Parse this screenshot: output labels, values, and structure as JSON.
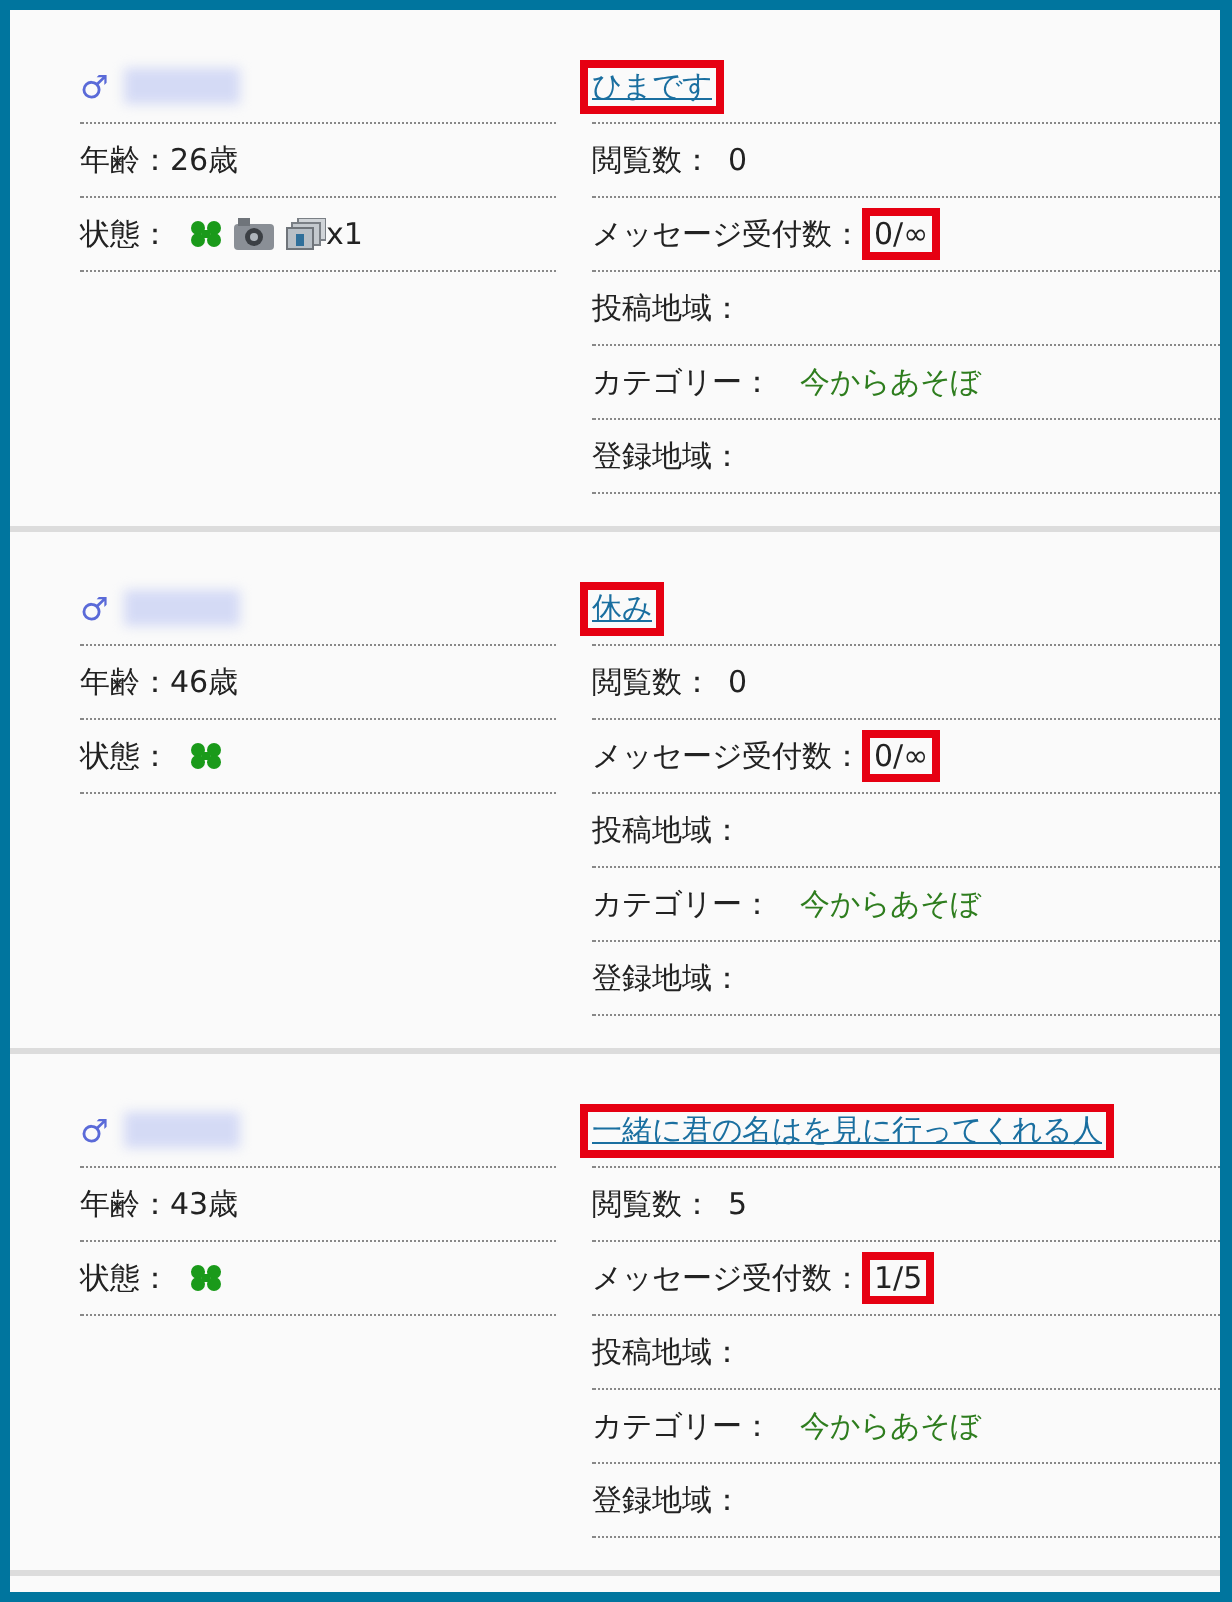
{
  "cards": [
    {
      "gender_symbol": "♂",
      "age": "年齢：26歳",
      "status_label": "状態：",
      "status_icons": [
        {
          "kind": "clover"
        },
        {
          "kind": "camera"
        },
        {
          "kind": "photos",
          "count": "x1"
        }
      ],
      "title": "ひまです",
      "title_highlighted": true,
      "fields": [
        {
          "kind": "plain",
          "label": "閲覧数：",
          "value": "0",
          "highlighted": false
        },
        {
          "kind": "plain",
          "label": "メッセージ受付数：",
          "value": "0/∞",
          "highlighted": true
        },
        {
          "kind": "hidden",
          "label": "投稿地域："
        },
        {
          "kind": "category",
          "label": "カテゴリー：",
          "value": "今からあそぼ",
          "highlighted": false
        },
        {
          "kind": "hidden",
          "label": "登録地域："
        }
      ]
    },
    {
      "gender_symbol": "♂",
      "age": "年齢：46歳",
      "status_label": "状態：",
      "status_icons": [
        {
          "kind": "clover"
        }
      ],
      "title": "休み",
      "title_highlighted": true,
      "fields": [
        {
          "kind": "plain",
          "label": "閲覧数：",
          "value": "0",
          "highlighted": false
        },
        {
          "kind": "plain",
          "label": "メッセージ受付数：",
          "value": "0/∞",
          "highlighted": true
        },
        {
          "kind": "hidden",
          "label": "投稿地域："
        },
        {
          "kind": "category",
          "label": "カテゴリー：",
          "value": "今からあそぼ",
          "highlighted": false
        },
        {
          "kind": "hidden",
          "label": "登録地域："
        }
      ]
    },
    {
      "gender_symbol": "♂",
      "age": "年齢：43歳",
      "status_label": "状態：",
      "status_icons": [
        {
          "kind": "clover"
        }
      ],
      "title": "一緒に君の名はを見に行ってくれる人",
      "title_highlighted": true,
      "fields": [
        {
          "kind": "plain",
          "label": "閲覧数：",
          "value": "5",
          "highlighted": false
        },
        {
          "kind": "plain",
          "label": "メッセージ受付数：",
          "value": "1/5",
          "highlighted": true
        },
        {
          "kind": "hidden",
          "label": "投稿地域："
        },
        {
          "kind": "category",
          "label": "カテゴリー：",
          "value": "今からあそぼ",
          "highlighted": false
        },
        {
          "kind": "hidden",
          "label": "登録地域："
        }
      ]
    }
  ]
}
